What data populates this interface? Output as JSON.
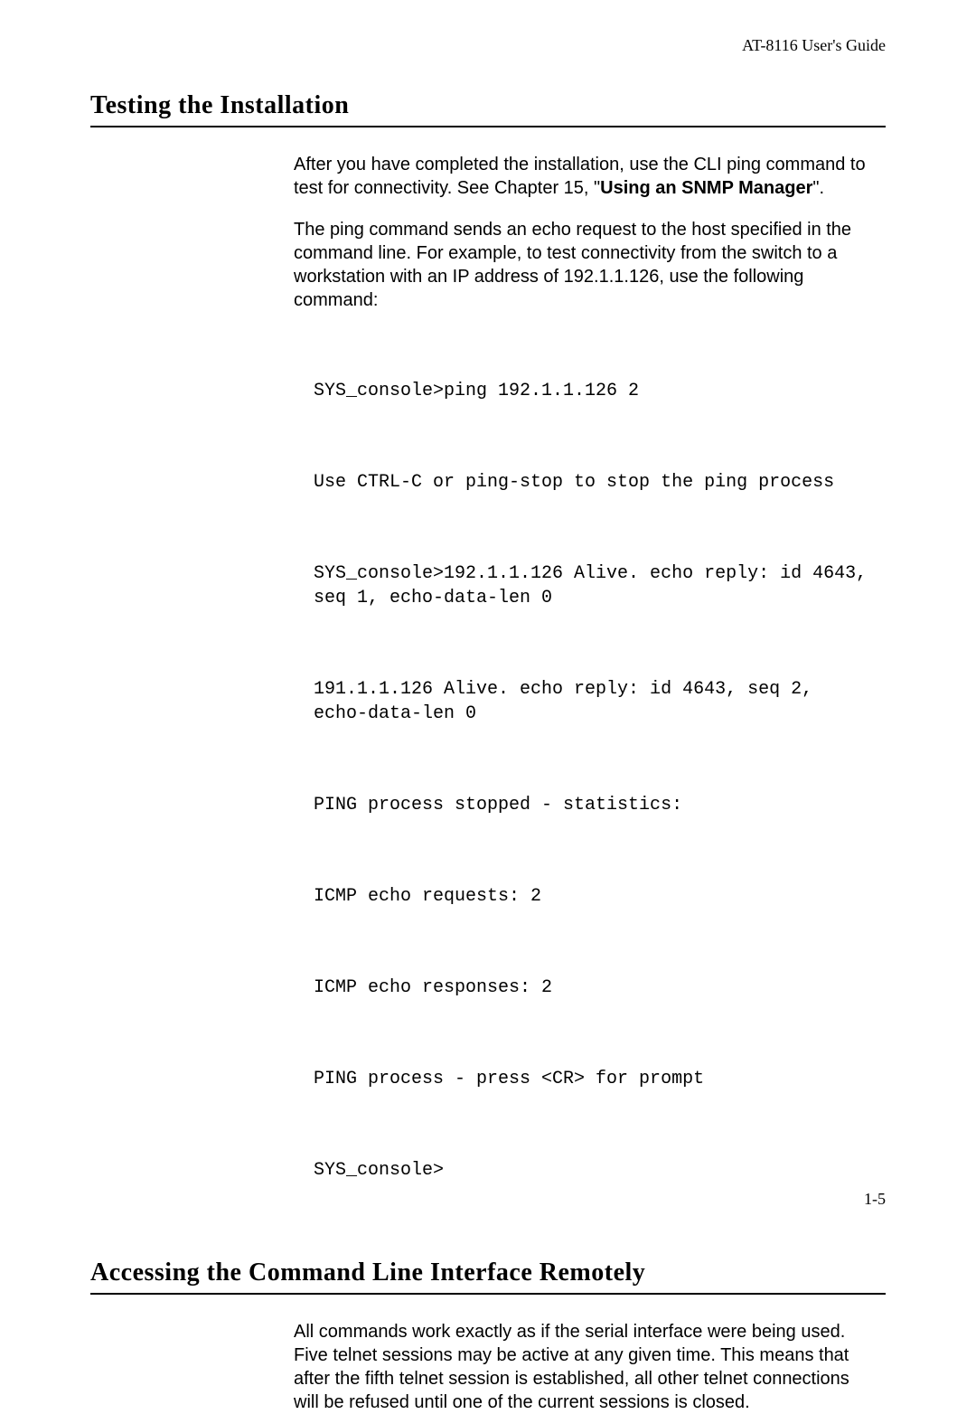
{
  "header": {
    "guide": "AT-8116 User's Guide"
  },
  "section1": {
    "title": "Testing the Installation",
    "para1_a": "After you have completed the installation, use the CLI ping command to test for connectivity. See Chapter 15, \"",
    "para1_bold": "Using an SNMP Manager",
    "para1_b": "\".",
    "para2": "The ping command sends an echo request to the host specified in the command line. For example, to test connectivity from the switch to a workstation with an IP address of 192.1.1.126, use the following command:",
    "code": {
      "l1": "SYS_console>ping 192.1.1.126 2",
      "l2": "Use CTRL-C or ping-stop to stop the ping process",
      "l3": "SYS_console>192.1.1.126 Alive. echo reply: id 4643, seq 1, echo-data-len 0",
      "l4": "191.1.1.126 Alive. echo reply: id 4643, seq 2, echo-data-len 0",
      "l5": "PING process stopped - statistics:",
      "l6": "ICMP echo requests: 2",
      "l7": "ICMP echo responses: 2",
      "l8": "PING process - press <CR> for prompt",
      "l9": "SYS_console>"
    }
  },
  "section2": {
    "title": "Accessing the Command Line Interface Remotely",
    "para1": "All commands work exactly as if the serial interface were being used. Five telnet sessions may be active at any given time. This means that after the fifth telnet session is established, all other telnet connections will be refused until one of the current sessions is closed."
  },
  "footer": {
    "page": "1-5"
  }
}
